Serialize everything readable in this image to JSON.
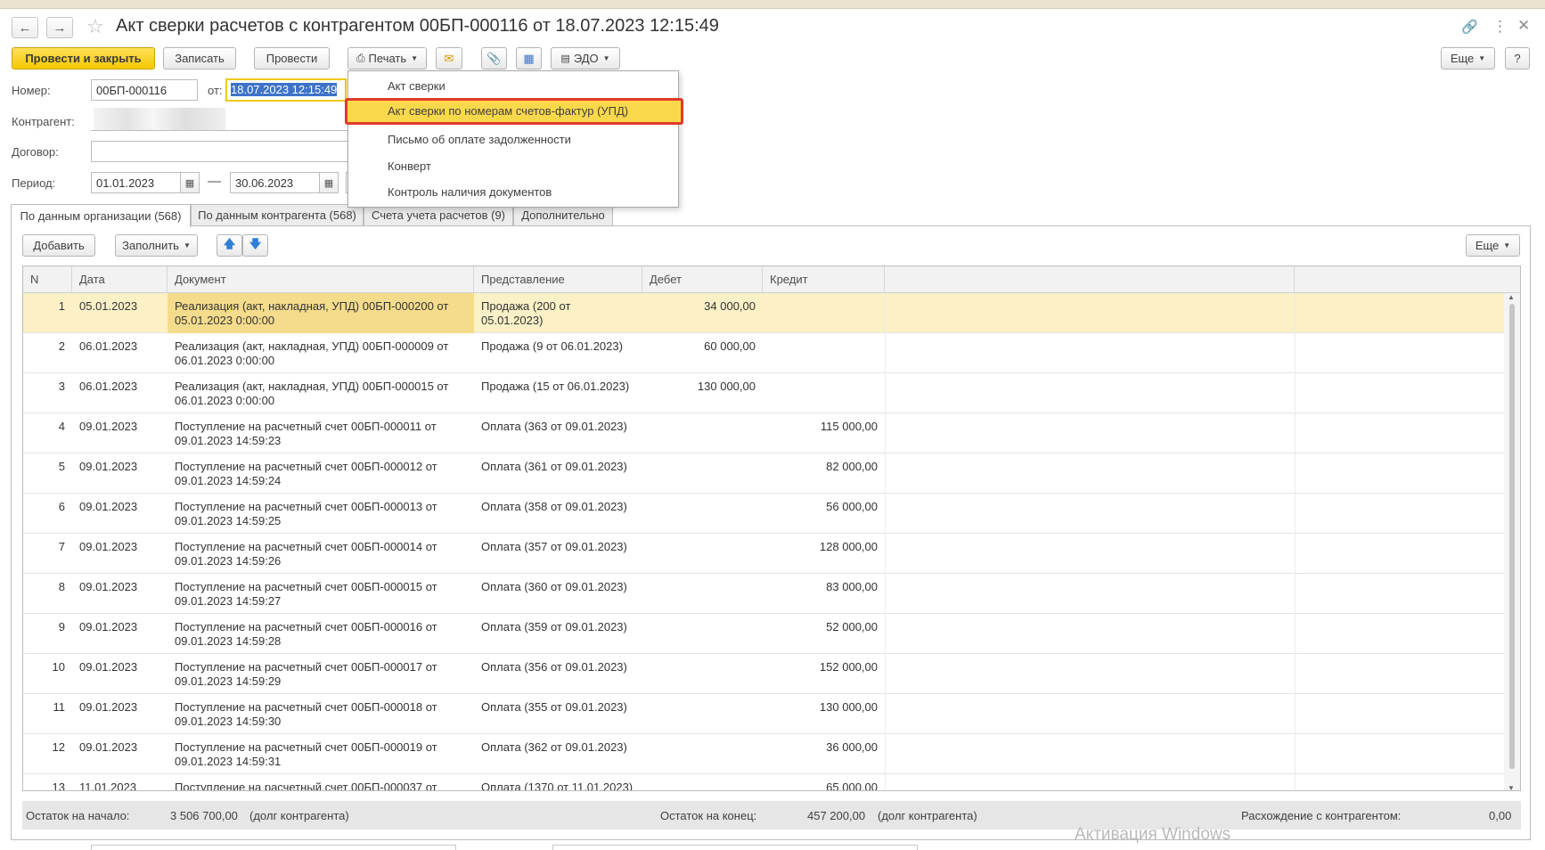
{
  "header": {
    "title": "Акт сверки расчетов с контрагентом 00БП-000116 от 18.07.2023 12:15:49",
    "back_icon": "arrow-left-icon",
    "forward_icon": "arrow-right-icon",
    "favorite_icon": "star-icon"
  },
  "toolbar": {
    "post_close": "Провести и закрыть",
    "save": "Записать",
    "post": "Провести",
    "print": "Печать",
    "edo": "ЭДО",
    "more": "Еще",
    "help": "?"
  },
  "form": {
    "number_label": "Номер:",
    "number_value": "00БП-000116",
    "date_label": "от:",
    "date_value": "18.07.2023 12:15:49",
    "counterparty_label": "Контрагент:",
    "contract_label": "Договор:",
    "period_label": "Период:",
    "period_from": "01.01.2023",
    "period_dash": "—",
    "period_to": "30.06.2023"
  },
  "print_menu": {
    "items": [
      "Акт сверки",
      "Акт сверки по номерам счетов-фактур (УПД)",
      "Письмо об оплате задолженности",
      "Конверт",
      "Контроль наличия документов"
    ]
  },
  "tabs": [
    "По данным организации (568)",
    "По данным контрагента (568)",
    "Счета учета расчетов (9)",
    "Дополнительно"
  ],
  "table_toolbar": {
    "add": "Добавить",
    "fill": "Заполнить",
    "more": "Еще"
  },
  "table": {
    "columns": [
      "N",
      "Дата",
      "Документ",
      "Представление",
      "Дебет",
      "Кредит"
    ],
    "rows": [
      {
        "n": "1",
        "date": "05.01.2023",
        "doc1": "Реализация (акт, накладная, УПД) 00БП-000200 от",
        "doc2": "05.01.2023 0:00:00",
        "pres1": "Продажа (200 от",
        "pres2": "05.01.2023)",
        "debit": "34 000,00",
        "credit": ""
      },
      {
        "n": "2",
        "date": "06.01.2023",
        "doc1": "Реализация (акт, накладная, УПД) 00БП-000009 от",
        "doc2": "06.01.2023 0:00:00",
        "pres1": "Продажа (9 от 06.01.2023)",
        "pres2": "",
        "debit": "60 000,00",
        "credit": ""
      },
      {
        "n": "3",
        "date": "06.01.2023",
        "doc1": "Реализация (акт, накладная, УПД) 00БП-000015 от",
        "doc2": "06.01.2023 0:00:00",
        "pres1": "Продажа (15 от 06.01.2023)",
        "pres2": "",
        "debit": "130 000,00",
        "credit": ""
      },
      {
        "n": "4",
        "date": "09.01.2023",
        "doc1": "Поступление на расчетный счет 00БП-000011 от",
        "doc2": "09.01.2023 14:59:23",
        "pres1": "Оплата (363 от 09.01.2023)",
        "pres2": "",
        "debit": "",
        "credit": "115 000,00"
      },
      {
        "n": "5",
        "date": "09.01.2023",
        "doc1": "Поступление на расчетный счет 00БП-000012 от",
        "doc2": "09.01.2023 14:59:24",
        "pres1": "Оплата (361 от 09.01.2023)",
        "pres2": "",
        "debit": "",
        "credit": "82 000,00"
      },
      {
        "n": "6",
        "date": "09.01.2023",
        "doc1": "Поступление на расчетный счет 00БП-000013 от",
        "doc2": "09.01.2023 14:59:25",
        "pres1": "Оплата (358 от 09.01.2023)",
        "pres2": "",
        "debit": "",
        "credit": "56 000,00"
      },
      {
        "n": "7",
        "date": "09.01.2023",
        "doc1": "Поступление на расчетный счет 00БП-000014 от",
        "doc2": "09.01.2023 14:59:26",
        "pres1": "Оплата (357 от 09.01.2023)",
        "pres2": "",
        "debit": "",
        "credit": "128 000,00"
      },
      {
        "n": "8",
        "date": "09.01.2023",
        "doc1": "Поступление на расчетный счет 00БП-000015 от",
        "doc2": "09.01.2023 14:59:27",
        "pres1": "Оплата (360 от 09.01.2023)",
        "pres2": "",
        "debit": "",
        "credit": "83 000,00"
      },
      {
        "n": "9",
        "date": "09.01.2023",
        "doc1": "Поступление на расчетный счет 00БП-000016 от",
        "doc2": "09.01.2023 14:59:28",
        "pres1": "Оплата (359 от 09.01.2023)",
        "pres2": "",
        "debit": "",
        "credit": "52 000,00"
      },
      {
        "n": "10",
        "date": "09.01.2023",
        "doc1": "Поступление на расчетный счет 00БП-000017 от",
        "doc2": "09.01.2023 14:59:29",
        "pres1": "Оплата (356 от 09.01.2023)",
        "pres2": "",
        "debit": "",
        "credit": "152 000,00"
      },
      {
        "n": "11",
        "date": "09.01.2023",
        "doc1": "Поступление на расчетный счет 00БП-000018 от",
        "doc2": "09.01.2023 14:59:30",
        "pres1": "Оплата (355 от 09.01.2023)",
        "pres2": "",
        "debit": "",
        "credit": "130 000,00"
      },
      {
        "n": "12",
        "date": "09.01.2023",
        "doc1": "Поступление на расчетный счет 00БП-000019 от",
        "doc2": "09.01.2023 14:59:31",
        "pres1": "Оплата (362 от 09.01.2023)",
        "pres2": "",
        "debit": "",
        "credit": "36 000,00"
      },
      {
        "n": "13",
        "date": "11.01.2023",
        "doc1": "Поступление на расчетный счет 00БП-000037 от",
        "doc2": "",
        "pres1": "Оплата (1370 от 11.01.2023)",
        "pres2": "",
        "debit": "",
        "credit": "65 000,00"
      }
    ]
  },
  "footer": {
    "start_label": "Остаток на начало:",
    "start_value": "3 506 700,00",
    "start_note": "(долг контрагента)",
    "end_label": "Остаток на конец:",
    "end_value": "457 200,00",
    "end_note": "(долг контрагента)",
    "diff_label": "Расхождение с контрагентом:",
    "diff_value": "0,00"
  },
  "watermark": "Активация Windows",
  "colors": {
    "accent_yellow": "#f5c800",
    "highlight_red": "#e03b2a",
    "selected_row": "#fbf0c6"
  }
}
